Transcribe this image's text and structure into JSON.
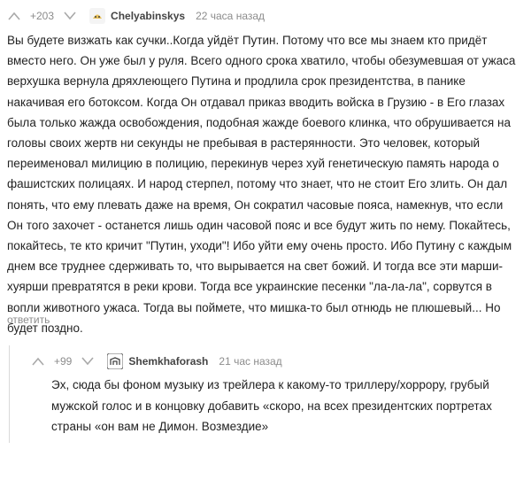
{
  "comment": {
    "score": "+203",
    "username": "Chelyabinskys",
    "timestamp": "22 часа назад",
    "body": "Вы будете визжать как сучки..Когда уйдёт Путин. Потому что все мы знаем кто придёт вместо него. Он уже был у руля. Всего одного срока хватило, чтобы обезумевшая от ужаса верхушка вернула дряхлеющего Путина и продлила срок президентства, в панике накачивая его ботоксом. Когда Он отдавал приказ вводить войска в Грузию - в Его глазах была только жажда освобождения, подобная жажде боевого клинка, что обрушивается на головы своих жертв ни секунды не пребывая в растерянности. Это человек, который переименовал милицию в полицию, перекинув через хуй генетическую память народа о фашистских полицаях. И народ стерпел, потому что знает, что не стоит Его злить. Он дал понять, что ему плевать даже на время, Он сократил часовые пояса, намекнув, что если Он того захочет - останется лишь один часовой пояс и все будут жить по нему. Покайтесь, покайтесь, те кто кричит \"Путин, уходи\"! Ибо уйти ему очень просто. Ибо Путину с каждым днем все труднее сдерживать то, что вырывается на свет божий. И тогда все эти марши-хуярши превратятся в реки крови. Тогда все украинские песенки \"ла-ла-ла\", сорвутся в вопли животного ужаса. Тогда вы поймете, что мишка-то был отнюдь не плюшевый... Но будет поздно.",
    "reply_label": "ответить"
  },
  "reply": {
    "score": "+99",
    "username": "Shemkhaforash",
    "timestamp": "21 час назад",
    "body": "Эх, сюда бы фоном музыку из трейлера к какому-то триллеру/хоррору, грубый мужской голос и в концовку добавить «скоро, на всех президентских портретах страны «он вам не Димон. Возмездие»"
  },
  "icons": {
    "upvote": "upvote-icon",
    "downvote": "downvote-icon",
    "avatar_comment": "avatar-icon",
    "avatar_reply": "avatar-icon"
  },
  "colors": {
    "meta_text": "#8c8c8c",
    "body_text": "#222222",
    "thread_line": "#d9d9d9"
  }
}
